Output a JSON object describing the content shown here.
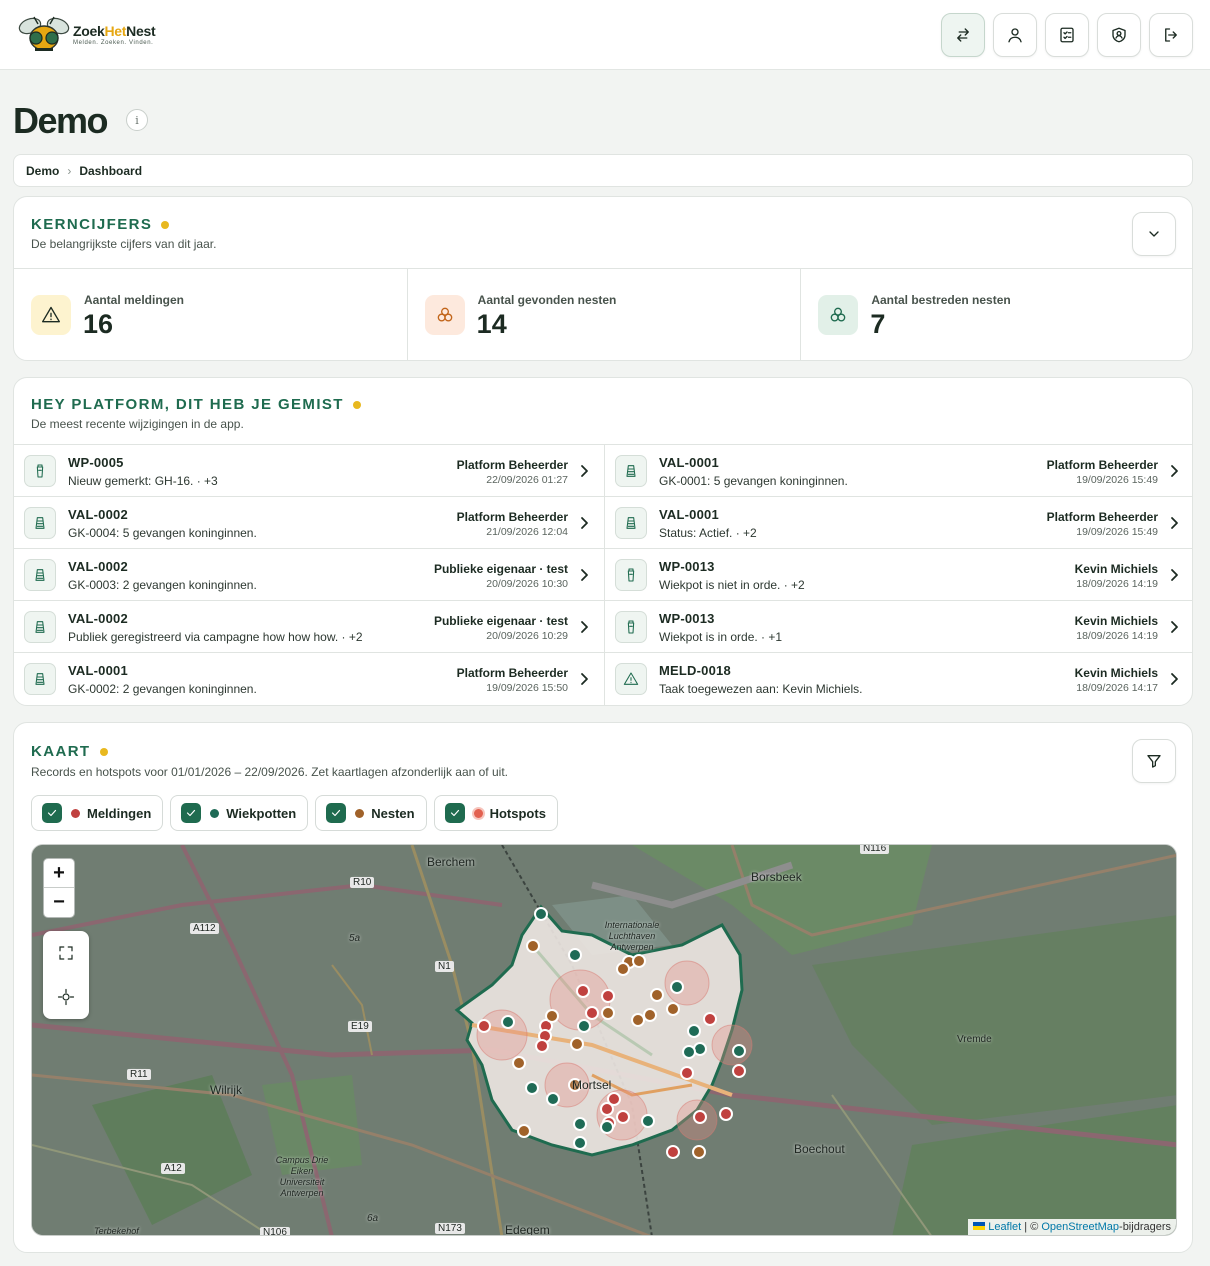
{
  "brand": {
    "name_part1": "Zoek",
    "name_accent": "Het",
    "name_part2": "Nest",
    "tagline": "Melden. Zoeken. Vinden."
  },
  "topbar": {
    "actions": [
      "switch-icon",
      "user-icon",
      "checklist-icon",
      "shield-icon",
      "logout-icon"
    ]
  },
  "page": {
    "title": "Demo",
    "breadcrumb": [
      "Demo",
      "Dashboard"
    ]
  },
  "kerncijfers": {
    "title": "KERNCIJFERS",
    "subtitle": "De belangrijkste cijfers van dit jaar.",
    "stats": [
      {
        "label": "Aantal meldingen",
        "value": "16",
        "icon": "warning-icon",
        "color": "#c49a0e"
      },
      {
        "label": "Aantal gevonden nesten",
        "value": "14",
        "icon": "nest-icon",
        "color": "#c2651a"
      },
      {
        "label": "Aantal bestreden nesten",
        "value": "7",
        "icon": "nest-icon",
        "color": "#1f6b4f"
      }
    ]
  },
  "feed": {
    "title": "HEY PLATFORM, DIT HEB JE GEMIST",
    "subtitle": "De meest recente wijzigingen in de app.",
    "items": [
      {
        "code": "WP-0005",
        "desc": "Nieuw gemerkt: GH-16. · +3",
        "actor": "Platform Beheerder",
        "time": "22/09/2026 01:27",
        "icon": "wiekpot-icon"
      },
      {
        "code": "VAL-0001",
        "desc": "GK-0001: 5 gevangen koninginnen.",
        "actor": "Platform Beheerder",
        "time": "19/09/2026 15:49",
        "icon": "trap-icon"
      },
      {
        "code": "VAL-0002",
        "desc": "GK-0004: 5 gevangen koninginnen.",
        "actor": "Platform Beheerder",
        "time": "21/09/2026 12:04",
        "icon": "trap-icon"
      },
      {
        "code": "VAL-0001",
        "desc": "Status: Actief. · +2",
        "actor": "Platform Beheerder",
        "time": "19/09/2026 15:49",
        "icon": "trap-icon"
      },
      {
        "code": "VAL-0002",
        "desc": "GK-0003: 2 gevangen koninginnen.",
        "actor": "Publieke eigenaar · test",
        "time": "20/09/2026 10:30",
        "icon": "trap-icon"
      },
      {
        "code": "WP-0013",
        "desc": "Wiekpot is niet in orde. · +2",
        "actor": "Kevin Michiels",
        "time": "18/09/2026 14:19",
        "icon": "wiekpot-icon"
      },
      {
        "code": "VAL-0002",
        "desc": "Publiek geregistreerd via campagne how how how. · +2",
        "actor": "Publieke eigenaar · test",
        "time": "20/09/2026 10:29",
        "icon": "trap-icon"
      },
      {
        "code": "WP-0013",
        "desc": "Wiekpot is in orde. · +1",
        "actor": "Kevin Michiels",
        "time": "18/09/2026 14:19",
        "icon": "wiekpot-icon"
      },
      {
        "code": "VAL-0001",
        "desc": "GK-0002: 2 gevangen koninginnen.",
        "actor": "Platform Beheerder",
        "time": "19/09/2026 15:50",
        "icon": "trap-icon"
      },
      {
        "code": "MELD-0018",
        "desc": "Taak toegewezen aan: Kevin Michiels.",
        "actor": "Kevin Michiels",
        "time": "18/09/2026 14:17",
        "icon": "warning-icon"
      }
    ]
  },
  "map": {
    "title": "KAART",
    "subtitle": "Records en hotspots voor 01/01/2026 – 22/09/2026. Zet kaartlagen afzonderlijk aan of uit.",
    "layers": [
      {
        "label": "Meldingen",
        "color": "#c0413f",
        "checked": true
      },
      {
        "label": "Wiekpotten",
        "color": "#1f6b56",
        "checked": true
      },
      {
        "label": "Nesten",
        "color": "#a0622a",
        "checked": true
      },
      {
        "label": "Hotspots",
        "color": "#e2604f",
        "checked": true
      }
    ],
    "zoom_in": "+",
    "zoom_out": "−",
    "place_labels": [
      "Berchem",
      "Borsbeek",
      "Wilrijk",
      "Mortsel",
      "Vremde",
      "Boechout",
      "Edegem",
      "R10",
      "R11",
      "A112",
      "N1",
      "E19",
      "A12",
      "N116",
      "N173",
      "N106",
      "5a",
      "6a",
      "Terbekehof",
      "Internationale Luchthaven Antwerpen",
      "Campus Drie Eiken Universiteit Antwerpen"
    ],
    "attribution": {
      "leaflet": "Leaflet",
      "sep": " | © ",
      "osm": "OpenStreetMap",
      "suffix": "-bijdragers"
    }
  }
}
